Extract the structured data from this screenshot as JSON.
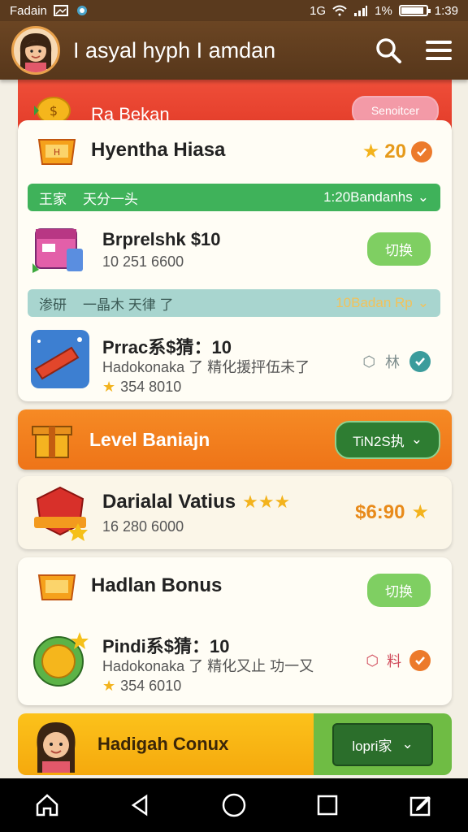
{
  "status_bar": {
    "carrier": "Fadain",
    "network": "1G",
    "battery_pct": "1%",
    "battery_level": 0.9,
    "time": "1:39"
  },
  "app_bar": {
    "title": "I asyal hyph I amdan",
    "avatar_icon": "avatar-girl",
    "search_icon": "search-icon",
    "menu_icon": "hamburger-menu-icon"
  },
  "banner_red": {
    "label": "Ra Bekan",
    "button_label": "Senoitcer"
  },
  "card1": {
    "title": "Hyentha Hiasa",
    "rating": "20",
    "strip1": {
      "tag": "王家",
      "desc": "天分一头",
      "meta": "1:20Bandanhs"
    },
    "item1": {
      "title": "Brprelshk $10",
      "sub": "10 251 6600",
      "button": "切换"
    },
    "strip2": {
      "tag": "渗研",
      "desc": "一晶木 天律 了",
      "meta": "10Badan Rp"
    },
    "item2": {
      "title": "Prrac系$猜：10",
      "sub": "Hadokonaka 了 精化援抨伍未了",
      "rating": "354 8010",
      "action_label": "林"
    }
  },
  "banner_orange": {
    "label": "Level Baniajn",
    "button_label": "TiN2S执"
  },
  "card2": {
    "title": "Darialal Vatius",
    "sub": "16 280 6000",
    "price": "$6:90"
  },
  "card3": {
    "title": "Hadlan Bonus",
    "button": "切换",
    "item": {
      "title": "Pindi系$猜：10",
      "sub": "Hadokonaka 了 精化又止 功一又",
      "rating": "354 6010",
      "action_label": "料"
    }
  },
  "bottom_banner": {
    "label": "Hadigah Conux",
    "button_label": "lopri家"
  },
  "nav": {
    "home_icon": "home-icon",
    "back_icon": "back-icon",
    "circle_icon": "circle-home-icon",
    "square_icon": "recents-icon",
    "edit_icon": "edit-icon"
  },
  "colors": {
    "appbar": "#5a3a1e",
    "red_banner": "#e23a27",
    "orange_banner": "#ee7418",
    "green": "#3fb25a",
    "gold": "#f5a90d"
  }
}
